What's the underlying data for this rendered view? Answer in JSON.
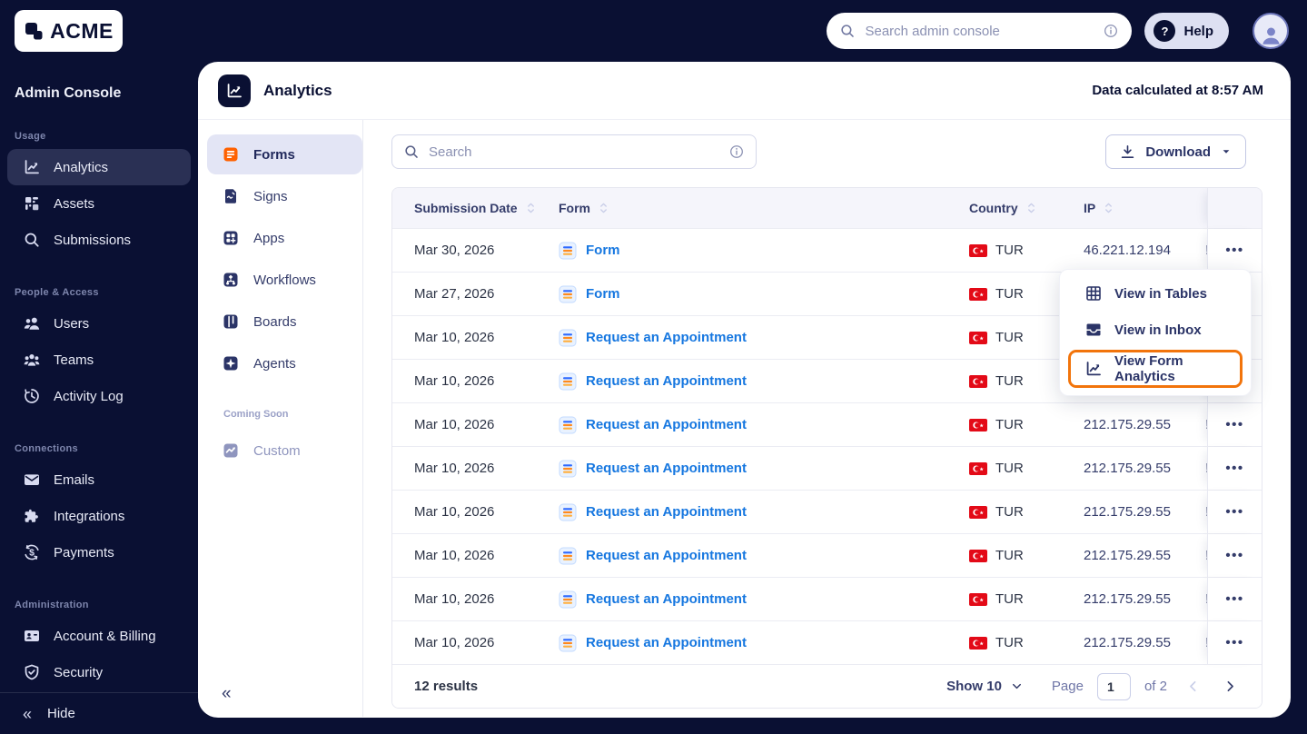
{
  "topbar": {
    "logo_text": "ACME",
    "search_placeholder": "Search admin console",
    "help_label": "Help"
  },
  "sidebar": {
    "title": "Admin Console",
    "hide_label": "Hide",
    "sections": [
      {
        "label": "Usage",
        "items": [
          {
            "label": "Analytics",
            "icon": "analytics-icon",
            "active": true
          },
          {
            "label": "Assets",
            "icon": "assets-icon",
            "active": false
          },
          {
            "label": "Submissions",
            "icon": "submissions-icon",
            "active": false
          }
        ]
      },
      {
        "label": "People & Access",
        "items": [
          {
            "label": "Users",
            "icon": "users-icon",
            "active": false
          },
          {
            "label": "Teams",
            "icon": "teams-icon",
            "active": false
          },
          {
            "label": "Activity Log",
            "icon": "activity-log-icon",
            "active": false
          }
        ]
      },
      {
        "label": "Connections",
        "items": [
          {
            "label": "Emails",
            "icon": "emails-icon",
            "active": false
          },
          {
            "label": "Integrations",
            "icon": "integrations-icon",
            "active": false
          },
          {
            "label": "Payments",
            "icon": "payments-icon",
            "active": false
          }
        ]
      },
      {
        "label": "Administration",
        "items": [
          {
            "label": "Account & Billing",
            "icon": "billing-icon",
            "active": false
          },
          {
            "label": "Security",
            "icon": "security-icon",
            "active": false
          }
        ]
      }
    ]
  },
  "panel": {
    "title": "Analytics",
    "calculated_at": "Data calculated at 8:57 AM",
    "nav": {
      "items": [
        {
          "label": "Forms",
          "icon": "forms-icon",
          "active": true
        },
        {
          "label": "Signs",
          "icon": "signs-icon",
          "active": false
        },
        {
          "label": "Apps",
          "icon": "apps-icon",
          "active": false
        },
        {
          "label": "Workflows",
          "icon": "workflows-icon",
          "active": false
        },
        {
          "label": "Boards",
          "icon": "boards-icon",
          "active": false
        },
        {
          "label": "Agents",
          "icon": "agents-icon",
          "active": false
        }
      ],
      "coming_soon_label": "Coming Soon",
      "coming_soon_items": [
        {
          "label": "Custom",
          "icon": "custom-icon"
        }
      ]
    },
    "toolbar": {
      "search_placeholder": "Search",
      "download_label": "Download"
    },
    "table": {
      "columns": [
        "Submission Date",
        "Form",
        "Country",
        "IP"
      ],
      "rows": [
        {
          "date": "Mar 30, 2026",
          "form": "Form",
          "country": "TUR",
          "ip": "46.221.12.194",
          "clipped": "!"
        },
        {
          "date": "Mar 27, 2026",
          "form": "Form",
          "country": "TUR",
          "ip": "",
          "clipped": ""
        },
        {
          "date": "Mar 10, 2026",
          "form": "Request an Appointment",
          "country": "TUR",
          "ip": "",
          "clipped": ""
        },
        {
          "date": "Mar 10, 2026",
          "form": "Request an Appointment",
          "country": "TUR",
          "ip": "",
          "clipped": ""
        },
        {
          "date": "Mar 10, 2026",
          "form": "Request an Appointment",
          "country": "TUR",
          "ip": "212.175.29.55",
          "clipped": "!"
        },
        {
          "date": "Mar 10, 2026",
          "form": "Request an Appointment",
          "country": "TUR",
          "ip": "212.175.29.55",
          "clipped": "!"
        },
        {
          "date": "Mar 10, 2026",
          "form": "Request an Appointment",
          "country": "TUR",
          "ip": "212.175.29.55",
          "clipped": "!"
        },
        {
          "date": "Mar 10, 2026",
          "form": "Request an Appointment",
          "country": "TUR",
          "ip": "212.175.29.55",
          "clipped": "!"
        },
        {
          "date": "Mar 10, 2026",
          "form": "Request an Appointment",
          "country": "TUR",
          "ip": "212.175.29.55",
          "clipped": "!"
        },
        {
          "date": "Mar 10, 2026",
          "form": "Request an Appointment",
          "country": "TUR",
          "ip": "212.175.29.55",
          "clipped": "!"
        }
      ]
    },
    "footer": {
      "results": "12 results",
      "show_label": "Show 10",
      "page_label": "Page",
      "page_value": "1",
      "of_label": "of 2"
    }
  },
  "context_menu": {
    "items": [
      {
        "label": "View in Tables",
        "icon": "tables-icon",
        "highlighted": false
      },
      {
        "label": "View in Inbox",
        "icon": "inbox-icon",
        "highlighted": false
      },
      {
        "label": "View Form Analytics",
        "icon": "form-analytics-icon",
        "highlighted": true
      }
    ]
  },
  "colors": {
    "navy": "#0A1033",
    "accent_orange": "#FF6100",
    "highlight_orange": "#F2740B",
    "link_blue": "#1677E0",
    "flag_red": "#E30A17",
    "active_nav_bg": "#E3E5F5",
    "header_row_bg": "#F5F5FB"
  }
}
